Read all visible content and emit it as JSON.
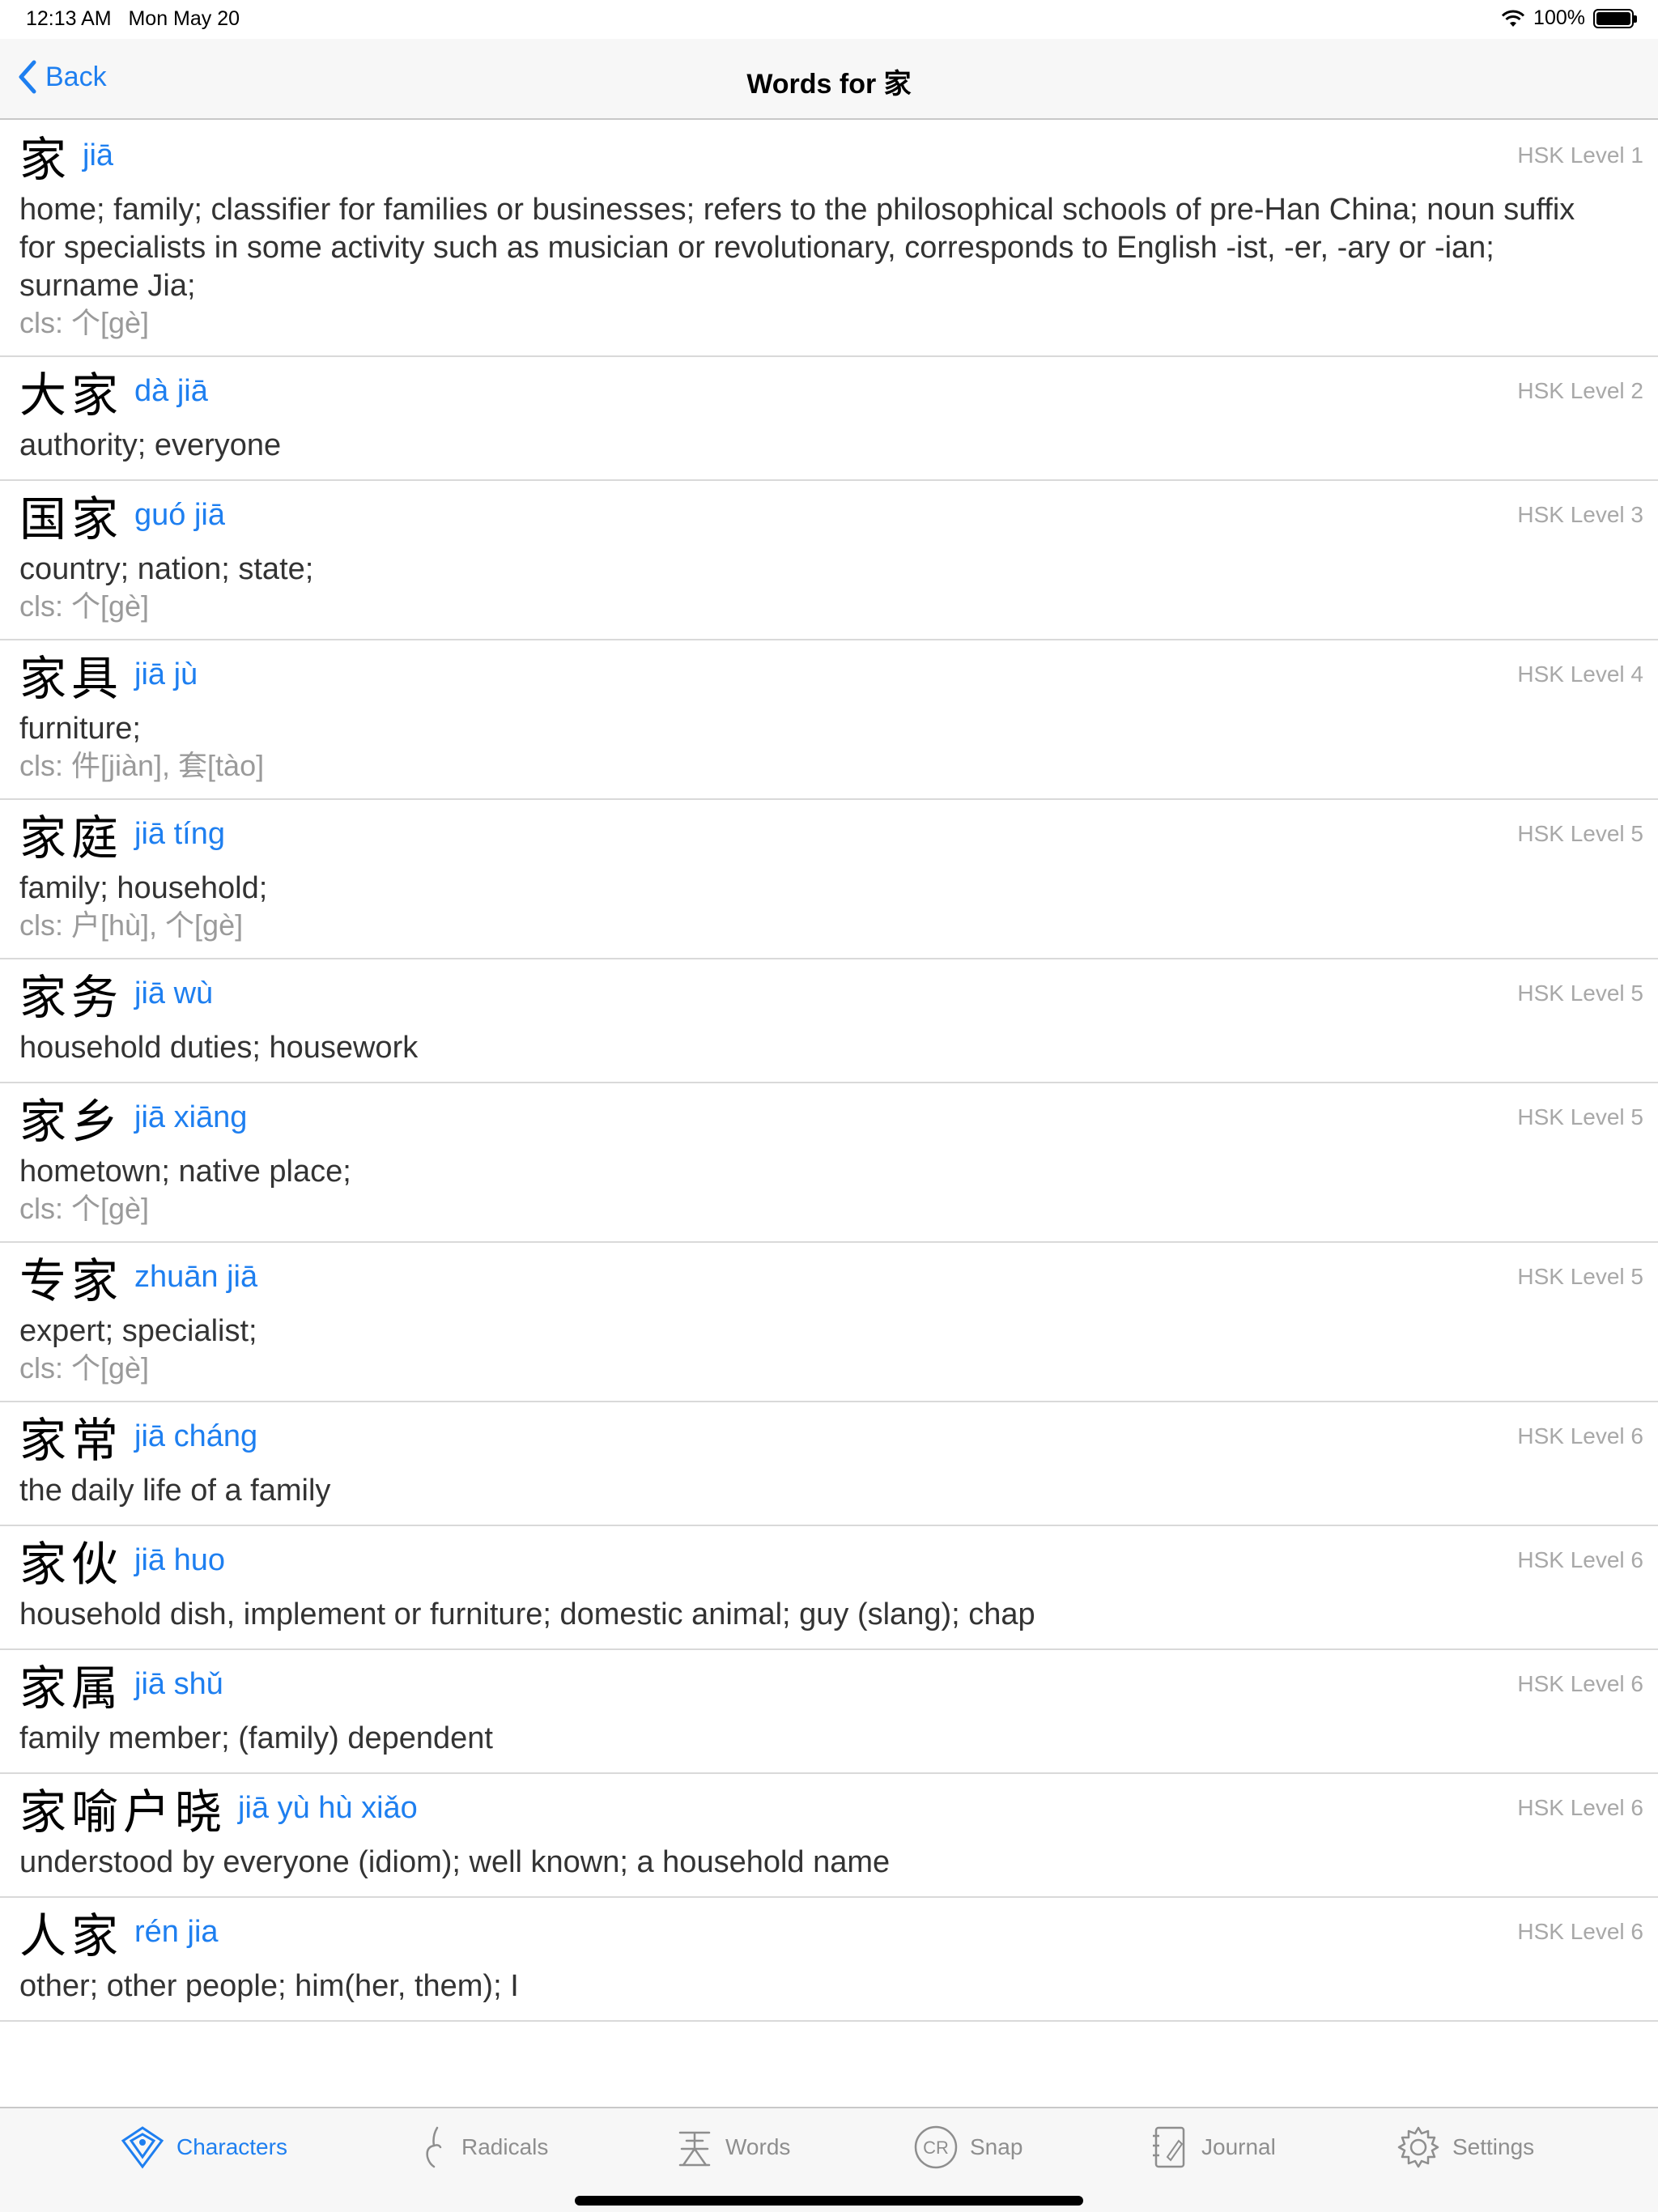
{
  "status_bar": {
    "time": "12:13 AM   Mon May 20",
    "battery": "100%"
  },
  "nav": {
    "back_label": "Back",
    "title": "Words for 家"
  },
  "words": [
    {
      "hanzi": "家",
      "pinyin": "jiā",
      "level": "HSK Level 1",
      "definition": "home; family; classifier for families or businesses; refers to the philosophical schools of pre-Han China; noun suffix for specialists in some activity such as musician or revolutionary, corresponds to English -ist, -er, -ary or -ian; surname Jia;",
      "classifier": "cls: 个[gè]"
    },
    {
      "hanzi": "大家",
      "pinyin": "dà jiā",
      "level": "HSK Level 2",
      "definition": "authority; everyone",
      "classifier": ""
    },
    {
      "hanzi": "国家",
      "pinyin": "guó jiā",
      "level": "HSK Level 3",
      "definition": "country; nation; state;",
      "classifier": "cls: 个[gè]"
    },
    {
      "hanzi": "家具",
      "pinyin": "jiā jù",
      "level": "HSK Level 4",
      "definition": "furniture;",
      "classifier": "cls: 件[jiàn], 套[tào]"
    },
    {
      "hanzi": "家庭",
      "pinyin": "jiā tíng",
      "level": "HSK Level 5",
      "definition": "family; household;",
      "classifier": "cls: 户[hù], 个[gè]"
    },
    {
      "hanzi": "家务",
      "pinyin": "jiā wù",
      "level": "HSK Level 5",
      "definition": "household duties; housework",
      "classifier": ""
    },
    {
      "hanzi": "家乡",
      "pinyin": "jiā xiāng",
      "level": "HSK Level 5",
      "definition": "hometown; native place;",
      "classifier": "cls: 个[gè]"
    },
    {
      "hanzi": "专家",
      "pinyin": "zhuān jiā",
      "level": "HSK Level 5",
      "definition": "expert; specialist;",
      "classifier": "cls: 个[gè]"
    },
    {
      "hanzi": "家常",
      "pinyin": "jiā cháng",
      "level": "HSK Level 6",
      "definition": "the daily life of a family",
      "classifier": ""
    },
    {
      "hanzi": "家伙",
      "pinyin": "jiā huo",
      "level": "HSK Level 6",
      "definition": "household dish, implement or furniture; domestic animal; guy (slang); chap",
      "classifier": ""
    },
    {
      "hanzi": "家属",
      "pinyin": "jiā shǔ",
      "level": "HSK Level 6",
      "definition": "family member; (family) dependent",
      "classifier": ""
    },
    {
      "hanzi": "家喻户晓",
      "pinyin": "jiā yù hù xiǎo",
      "level": "HSK Level 6",
      "definition": "understood by everyone (idiom); well known; a household name",
      "classifier": ""
    },
    {
      "hanzi": "人家",
      "pinyin": "rén jia",
      "level": "HSK Level 6",
      "definition": "other; other people; him(her, them); I",
      "classifier": ""
    }
  ],
  "tabs": [
    {
      "label": "Characters",
      "icon": "characters-icon",
      "active": true
    },
    {
      "label": "Radicals",
      "icon": "radicals-icon",
      "active": false
    },
    {
      "label": "Words",
      "icon": "words-icon",
      "active": false
    },
    {
      "label": "Snap",
      "icon": "snap-icon",
      "active": false
    },
    {
      "label": "Journal",
      "icon": "journal-icon",
      "active": false
    },
    {
      "label": "Settings",
      "icon": "settings-icon",
      "active": false
    }
  ],
  "colors": {
    "accent": "#1e7ff0",
    "secondary_text": "#a8a8a8"
  }
}
